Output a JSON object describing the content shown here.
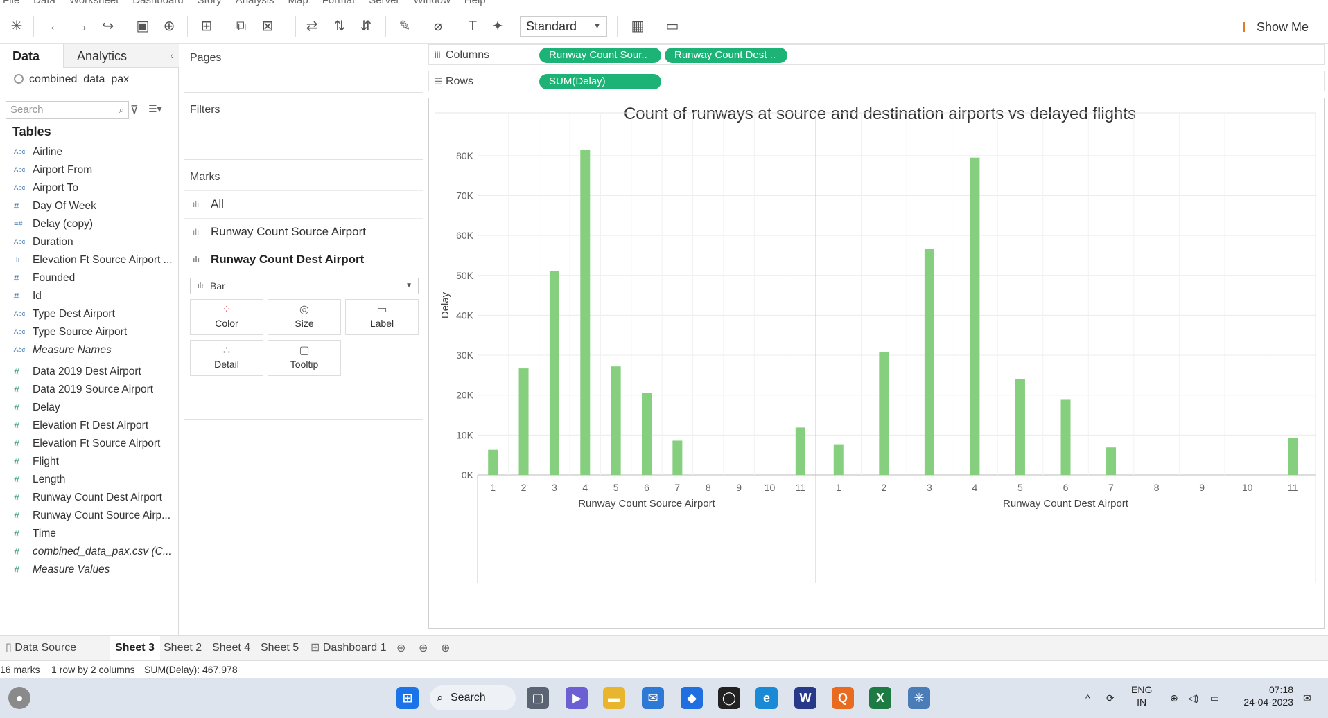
{
  "menu": [
    "File",
    "Data",
    "Worksheet",
    "Dashboard",
    "Story",
    "Analysis",
    "Map",
    "Format",
    "Server",
    "Window",
    "Help"
  ],
  "toolbar": {
    "fit_mode": "Standard",
    "show_me": "Show Me"
  },
  "data_pane": {
    "tab_data": "Data",
    "tab_analytics": "Analytics",
    "datasource": "combined_data_pax",
    "search_placeholder": "Search",
    "tables_header": "Tables",
    "dimensions": [
      {
        "type": "Abc",
        "name": "Airline"
      },
      {
        "type": "Abc",
        "name": "Airport From"
      },
      {
        "type": "Abc",
        "name": "Airport To"
      },
      {
        "type": "#",
        "name": "Day Of Week"
      },
      {
        "type": "=#",
        "name": "Delay (copy)"
      },
      {
        "type": "Abc",
        "name": "Duration"
      },
      {
        "type": "ılı",
        "name": "Elevation Ft Source Airport ..."
      },
      {
        "type": "#",
        "name": "Founded"
      },
      {
        "type": "#",
        "name": "Id"
      },
      {
        "type": "Abc",
        "name": "Type Dest Airport"
      },
      {
        "type": "Abc",
        "name": "Type Source Airport"
      },
      {
        "type": "Abc",
        "name": "Measure Names",
        "italic": true
      }
    ],
    "measures": [
      {
        "type": "#",
        "name": "Data 2019 Dest Airport"
      },
      {
        "type": "#",
        "name": "Data 2019 Source Airport"
      },
      {
        "type": "#",
        "name": "Delay"
      },
      {
        "type": "#",
        "name": "Elevation Ft Dest Airport"
      },
      {
        "type": "#",
        "name": "Elevation Ft Source Airport"
      },
      {
        "type": "#",
        "name": "Flight"
      },
      {
        "type": "#",
        "name": "Length"
      },
      {
        "type": "#",
        "name": "Runway Count Dest Airport"
      },
      {
        "type": "#",
        "name": "Runway Count Source Airp..."
      },
      {
        "type": "#",
        "name": "Time"
      },
      {
        "type": "#",
        "name": "combined_data_pax.csv (C...",
        "italic": true
      },
      {
        "type": "#",
        "name": "Measure Values",
        "italic": true
      }
    ]
  },
  "cards": {
    "pages": "Pages",
    "filters": "Filters",
    "marks": "Marks",
    "marks_rows": [
      "All",
      "Runway Count Source Airport",
      "Runway Count Dest Airport"
    ],
    "mark_type": "Bar",
    "buttons": [
      "Color",
      "Size",
      "Label",
      "Detail",
      "Tooltip"
    ]
  },
  "shelves": {
    "columns_label": "Columns",
    "rows_label": "Rows",
    "column_pills": [
      "Runway Count Sour..",
      "Runway Count Dest .."
    ],
    "row_pills": [
      "SUM(Delay)"
    ]
  },
  "colors": {
    "bar": "#86cf7e",
    "pill": "#1db376",
    "accent": "#e07a2e"
  },
  "chart_data": {
    "type": "bar",
    "title": "Count of runways at source and destination airports vs delayed flights",
    "ylabel": "Delay",
    "ylim": [
      0,
      85000
    ],
    "yticks": [
      0,
      10000,
      20000,
      30000,
      40000,
      50000,
      60000,
      70000,
      80000
    ],
    "ytick_labels": [
      "0K",
      "10K",
      "20K",
      "30K",
      "40K",
      "50K",
      "60K",
      "70K",
      "80K"
    ],
    "categories": [
      "1",
      "2",
      "3",
      "4",
      "5",
      "6",
      "7",
      "8",
      "9",
      "10",
      "11"
    ],
    "panes": [
      {
        "xlabel": "Runway Count Source Airport",
        "values": [
          6300,
          26700,
          51000,
          81500,
          27200,
          20500,
          8600,
          0,
          0,
          0,
          11900
        ]
      },
      {
        "xlabel": "Runway Count Dest Airport",
        "values": [
          7700,
          30700,
          56700,
          79500,
          24000,
          19000,
          6900,
          0,
          0,
          0,
          9300
        ]
      }
    ],
    "grid": true
  },
  "sheet_tabs": [
    "Data Source",
    "Sheet 3",
    "Sheet 2",
    "Sheet 4",
    "Sheet 5",
    "Dashboard 1"
  ],
  "active_sheet": "Sheet 3",
  "status": {
    "marks": "16 marks",
    "dims": "1 row by 2 columns",
    "sum": "SUM(Delay): 467,978"
  },
  "taskbar": {
    "search": "Search",
    "lang1": "ENG",
    "lang2": "IN",
    "time": "07:18",
    "date": "24-04-2023"
  }
}
